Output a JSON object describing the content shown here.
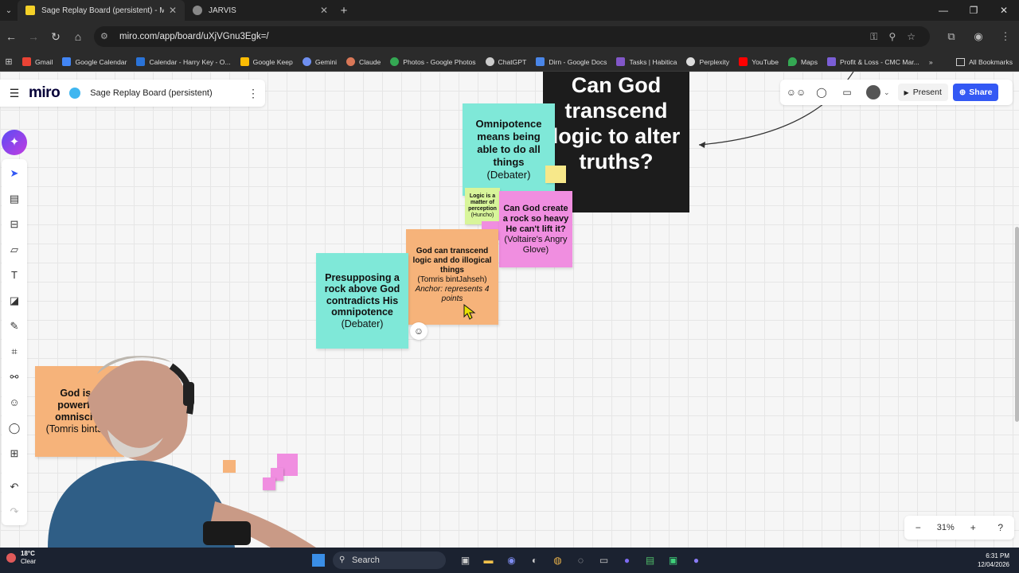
{
  "browser": {
    "tabs": [
      {
        "title": "Sage Replay Board (persistent) - Miro",
        "active": true
      },
      {
        "title": "JARVIS",
        "active": false
      }
    ],
    "url": "miro.com/app/board/uXjVGnu3Egk=/",
    "bookmarks": [
      "Gmail",
      "Google Calendar",
      "Calendar - Harry Key - O...",
      "Google Keep",
      "Gemini",
      "Claude",
      "Photos - Google Photos",
      "ChatGPT",
      "Dirn - Google Docs",
      "Tasks | Habitica",
      "Perplexity",
      "YouTube",
      "Maps",
      "Profit & Loss - CMC Mar..."
    ],
    "bookmarks_more": "»",
    "all_bookmarks": "All Bookmarks"
  },
  "board": {
    "logo": "miro",
    "name": "Sage Replay Board (persistent)",
    "present_label": "Present",
    "share_label": "Share",
    "zoom": "31%"
  },
  "cards": {
    "big_question": "Can God transcend logic to alter truths?",
    "omnipotence": {
      "title": "Omnipotence means being able to do all things",
      "author": "(Debater)"
    },
    "logic_perception": {
      "title": "Logic is a matter of perception",
      "author": "(Huncho)"
    },
    "rock": {
      "title": "Can God create a rock so heavy He can't lift it?",
      "author": "(Voltaire's Angry Glove)"
    },
    "transcend": {
      "title": "God can transcend logic and do illogical things",
      "author": "(Tomris bintJahseh)",
      "note": "Anchor: represents 4 points"
    },
    "presupposing": {
      "title": "Presupposing a rock above God contradicts His omnipotence",
      "author": "(Debater)"
    },
    "god_is": {
      "title": "God is a powerful, omniscien",
      "author": "(Tomris bintJah"
    }
  },
  "taskbar": {
    "temp": "18°C",
    "weather": "Clear",
    "search": "Search",
    "time": "6:31 PM",
    "date": "12/04/2026"
  },
  "colors": {
    "teal": "#7fe8d8",
    "pink": "#f08ee0",
    "orange": "#f6b37a",
    "lime": "#d8f59a",
    "yellow": "#f7e88a",
    "black": "#1c1c1c",
    "accent": "#3358f4"
  }
}
